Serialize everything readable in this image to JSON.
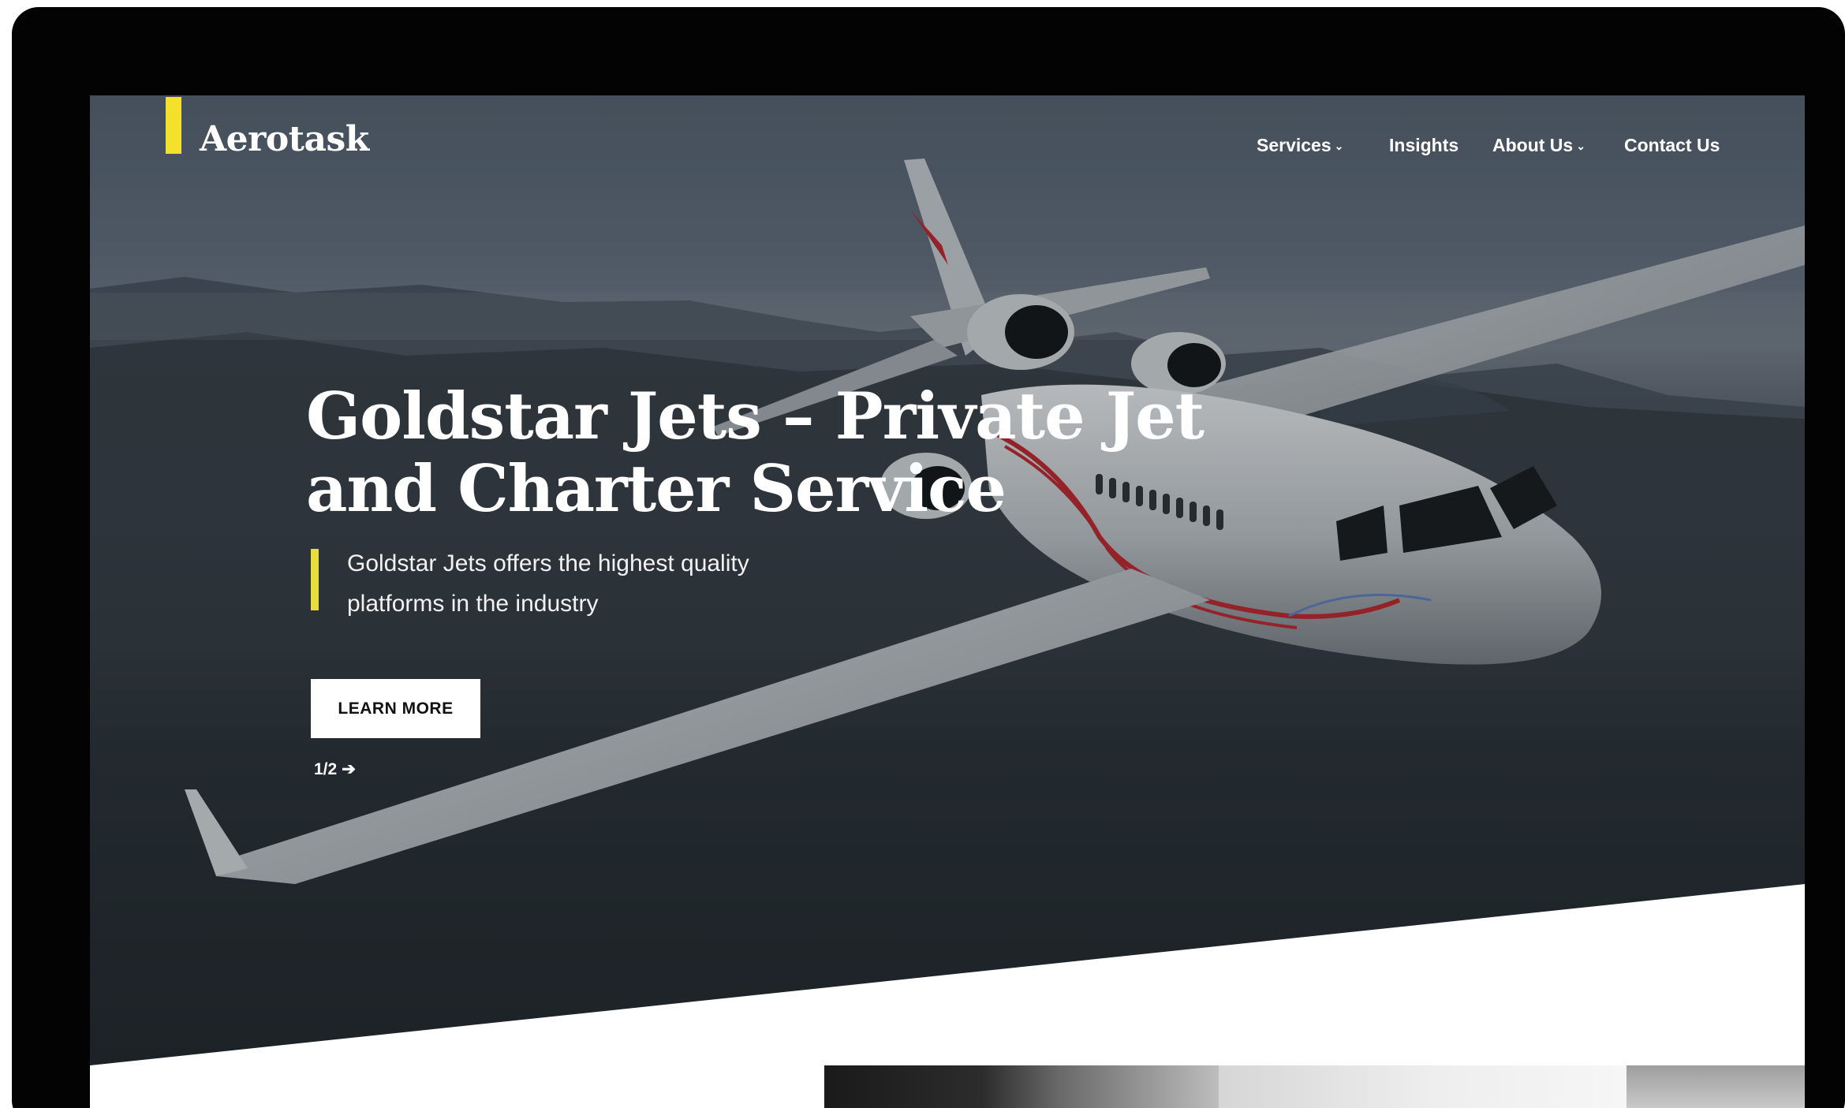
{
  "brand": {
    "name": "Aerotask",
    "accent": "#f4e12c"
  },
  "nav": {
    "items": [
      {
        "label": "Services",
        "has_dropdown": true
      },
      {
        "label": "Insights",
        "has_dropdown": false
      },
      {
        "label": "About Us",
        "has_dropdown": true
      },
      {
        "label": "Contact Us",
        "has_dropdown": false
      }
    ],
    "dropdown_icon": "chevron-down-icon"
  },
  "hero": {
    "headline_line1": "Goldstar Jets – Private Jet",
    "headline_line2": "and Charter Service",
    "subtitle_line1": "Goldstar Jets offers the highest quality",
    "subtitle_line2": "platforms in the industry",
    "cta_label": "LEARN MORE",
    "pager": "1/2",
    "pager_icon": "arrow-right-icon"
  },
  "colors": {
    "device_frame": "#030303",
    "hero_overlay": "#2b333b",
    "text": "#ffffff"
  }
}
